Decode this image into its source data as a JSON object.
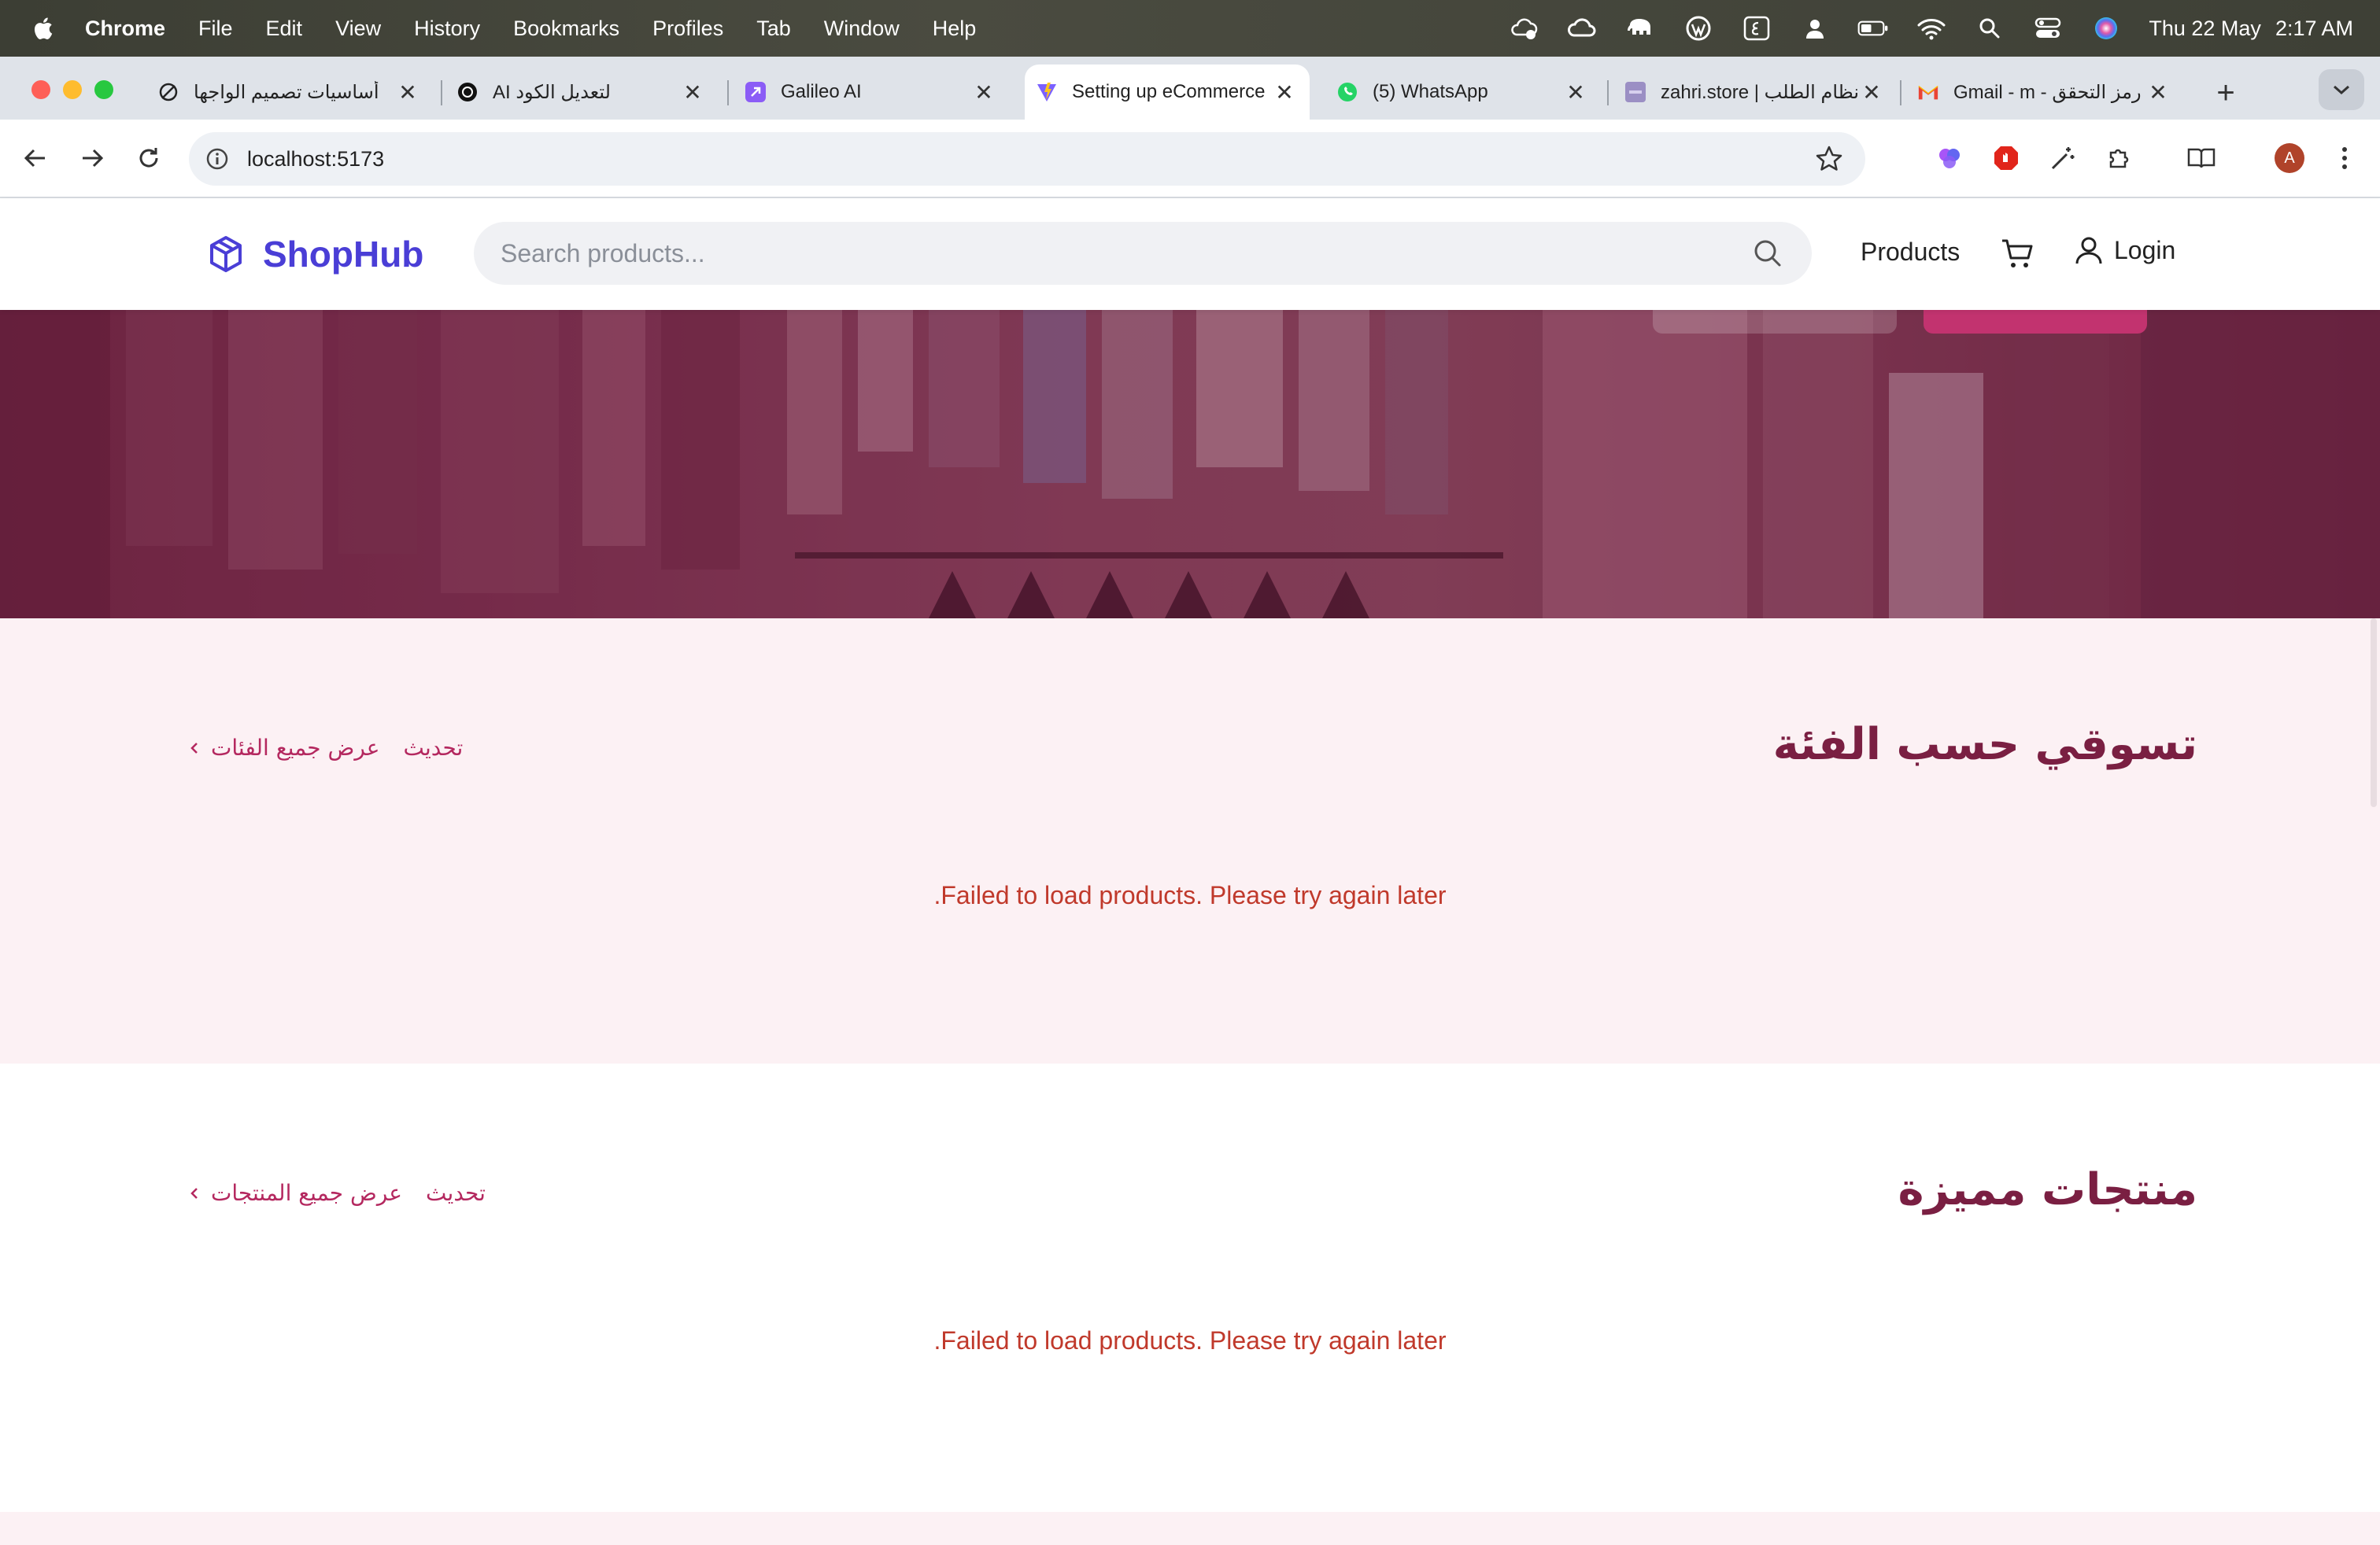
{
  "menubar": {
    "app_name": "Chrome",
    "items": [
      "File",
      "Edit",
      "View",
      "History",
      "Bookmarks",
      "Profiles",
      "Tab",
      "Window",
      "Help"
    ],
    "date": "Thu 22 May",
    "time": "2:17 AM"
  },
  "tabs": [
    {
      "title": "أساسيات تصميم الواجها",
      "icon": "perplexity-icon",
      "active": false
    },
    {
      "title": "لتعديل الكود AI",
      "icon": "openai-icon",
      "active": false
    },
    {
      "title": "Galileo AI",
      "icon": "galileo-icon",
      "active": false
    },
    {
      "title": "Setting up eCommerce",
      "icon": "vite-icon",
      "active": true
    },
    {
      "title": "(5) WhatsApp",
      "icon": "whatsapp-icon",
      "active": false
    },
    {
      "title": "zahri.store | نظام الطلب",
      "icon": "zahri-icon",
      "active": false
    },
    {
      "title": "رمز التحقق - Gmail - m",
      "icon": "gmail-icon",
      "active": false
    }
  ],
  "toolbar": {
    "url": "localhost:5173"
  },
  "header": {
    "brand": "ShopHub",
    "search_placeholder": "Search products...",
    "nav_products": "Products",
    "nav_login": "Login"
  },
  "category_section": {
    "title": "تسوقي حسب الفئة",
    "refresh_label": "تحديث",
    "view_all_label": "عرض جميع الفئات",
    "error": ".Failed to load products. Please try again later"
  },
  "featured_section": {
    "title": "منتجات مميزة",
    "refresh_label": "تحديث",
    "view_all_label": "عرض جميع المنتجات",
    "error": ".Failed to load products. Please try again later"
  },
  "colors": {
    "brand": "#4a3ed6",
    "section_title": "#7a1f42",
    "link": "#b4285f",
    "error": "#c0392b",
    "section_bg": "#fcf1f4"
  }
}
